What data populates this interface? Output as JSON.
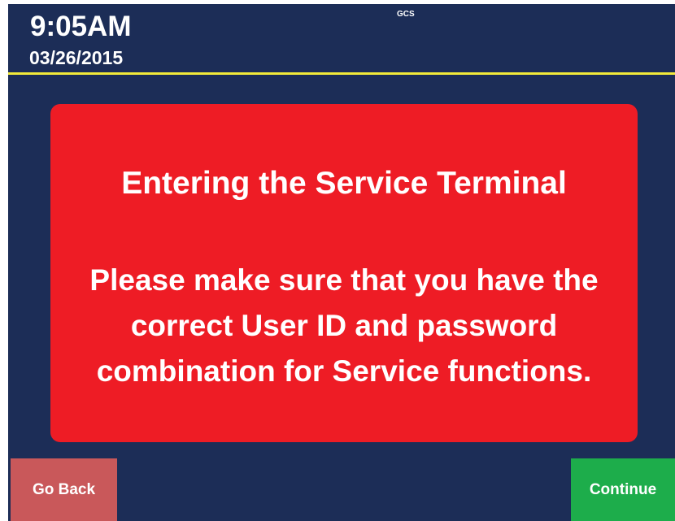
{
  "header": {
    "time": "9:05AM",
    "date": "03/26/2015",
    "system_label": "GCS"
  },
  "alert": {
    "title": "Entering the Service Terminal",
    "message": "Please make sure that you have the correct User ID and password combination for Service functions."
  },
  "buttons": {
    "back_label": "Go Back",
    "continue_label": "Continue"
  },
  "colors": {
    "background": "#1c2d57",
    "header_rule": "#f2ea3a",
    "alert": "#ee1c25",
    "go_back": "#c9585a",
    "continue": "#1dad4b"
  }
}
